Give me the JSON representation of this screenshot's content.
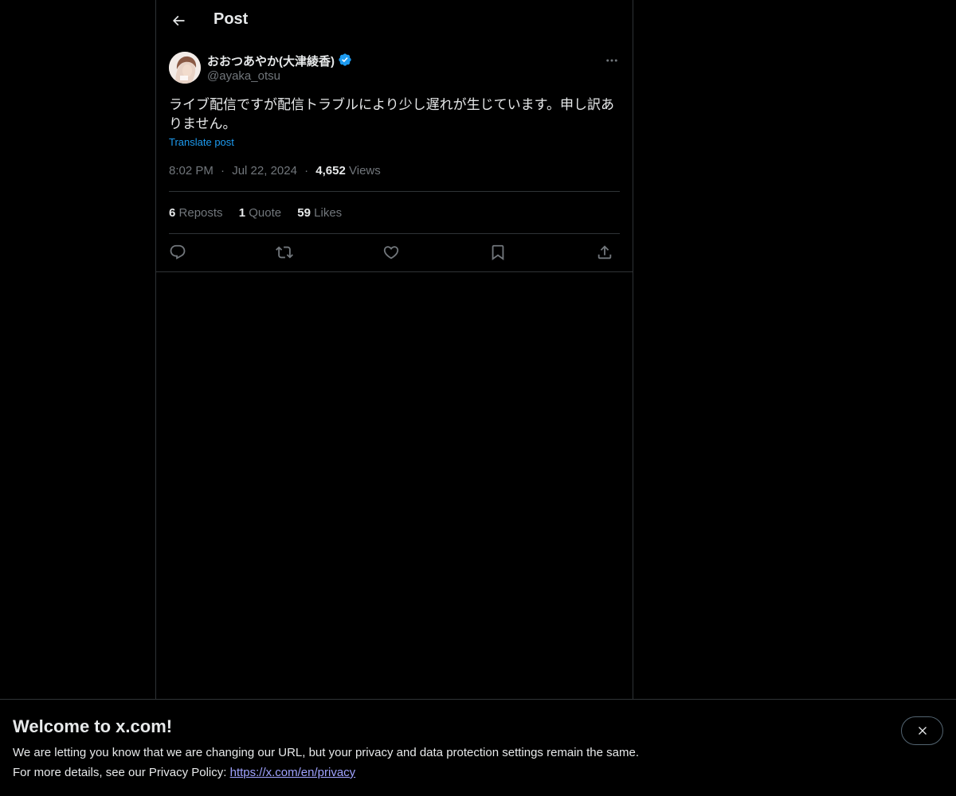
{
  "header": {
    "title": "Post"
  },
  "post": {
    "author_name": "おおつあやか(大津綾香)",
    "handle": "@ayaka_otsu",
    "text": "ライブ配信ですが配信トラブルにより少し遅れが生じています。申し訳ありません。",
    "translate_label": "Translate post",
    "time": "8:02 PM",
    "date": "Jul 22, 2024",
    "separator": "·",
    "views_count": "4,652",
    "views_label": "Views",
    "reposts_count": "6",
    "reposts_label": "Reposts",
    "quotes_count": "1",
    "quotes_label": "Quote",
    "likes_count": "59",
    "likes_label": "Likes"
  },
  "banner": {
    "title": "Welcome to x.com!",
    "line1": "We are letting you know that we are changing our URL, but your privacy and data protection settings remain the same.",
    "line2_prefix": "For more details, see our Privacy Policy:",
    "link_text": "https://x.com/en/privacy"
  },
  "colors": {
    "background": "#000000",
    "accent": "#1d9bf0",
    "muted": "#71767b",
    "border": "#2f3336",
    "link": "#a0a3ff"
  },
  "icons": {
    "back": "arrow-left-icon",
    "verified": "verified-badge-icon",
    "more": "more-horizontal-icon",
    "reply": "reply-icon",
    "repost": "repost-icon",
    "like": "heart-icon",
    "bookmark": "bookmark-icon",
    "share": "share-icon",
    "close": "close-icon"
  }
}
